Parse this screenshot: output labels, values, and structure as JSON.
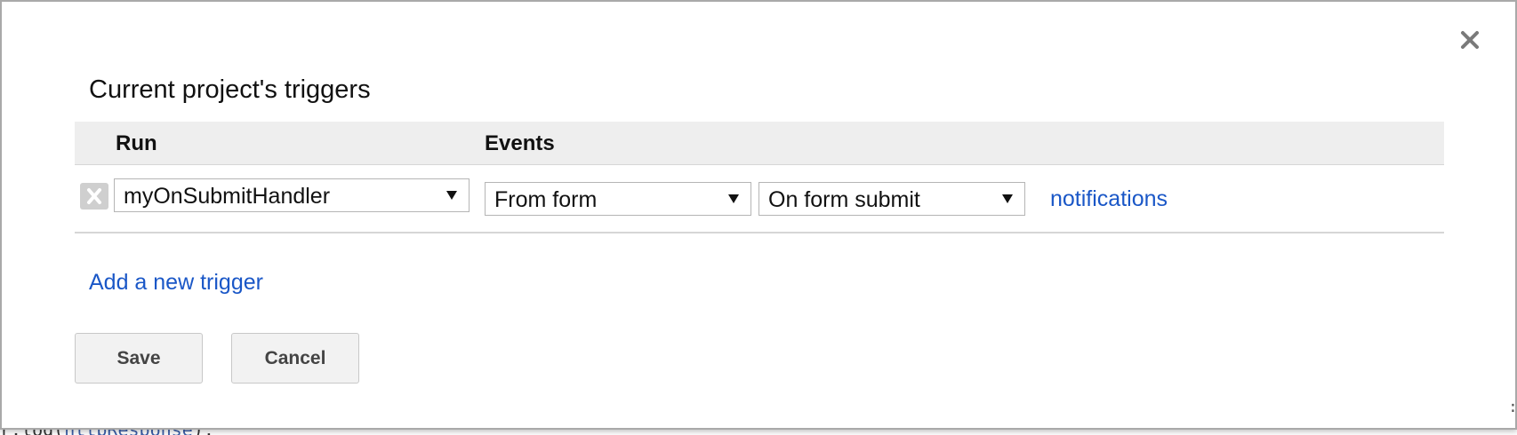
{
  "background": {
    "code_prefix": "r.log(",
    "code_var": "httpResponse",
    "code_suffix": ");"
  },
  "dialog": {
    "title": "Current project's triggers",
    "close_icon": "close-icon",
    "columns": {
      "run": "Run",
      "events": "Events"
    },
    "trigger": {
      "function": "myOnSubmitHandler",
      "source": "From form",
      "event": "On form submit",
      "notifications_label": "notifications",
      "delete_icon": "delete-icon"
    },
    "add_trigger_label": "Add a new trigger",
    "save_label": "Save",
    "cancel_label": "Cancel"
  },
  "colors": {
    "link": "#1a57c7",
    "header_bg": "#eeeeee",
    "button_bg": "#f2f2f2"
  }
}
